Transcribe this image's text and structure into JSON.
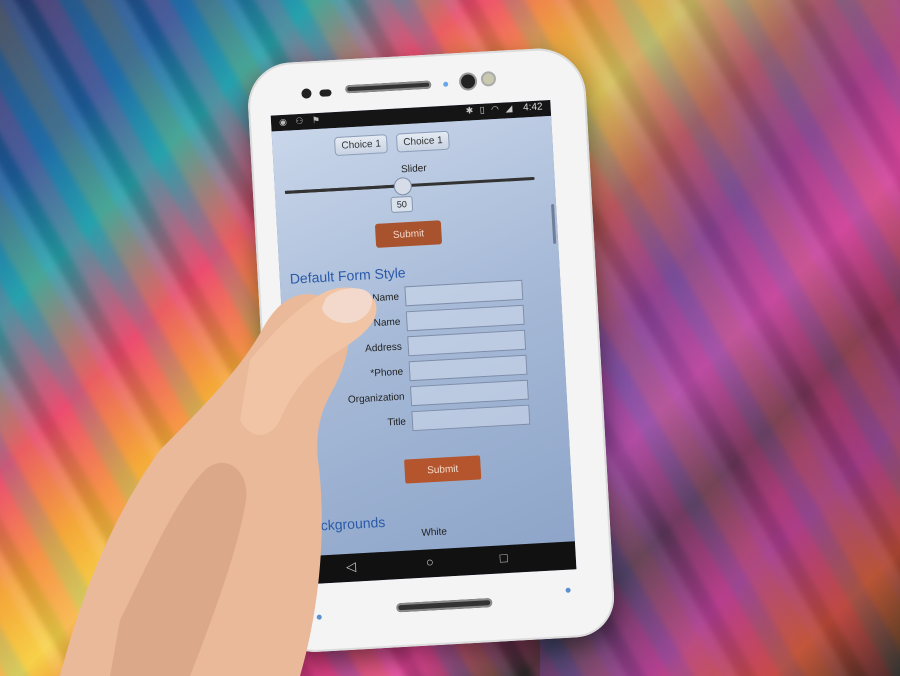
{
  "status_bar": {
    "time": "4:42",
    "left_icons": "notifications-icons",
    "right_icons": "bluetooth-vibrate-wifi-signal-battery"
  },
  "page": {
    "choices": [
      "Choice 1",
      "Choice 1"
    ],
    "slider": {
      "label": "Slider",
      "value": "50",
      "level": 0.5
    },
    "submit_top": "Submit",
    "form_section_title": "Default Form Style",
    "form_fields": [
      {
        "label": "Name"
      },
      {
        "label": "Name"
      },
      {
        "label": "Address"
      },
      {
        "label": "*Phone"
      },
      {
        "label": "Organization"
      },
      {
        "label": "Title"
      }
    ],
    "submit_form": "Submit",
    "backgrounds_title": "Backgrounds",
    "backgrounds_value": "White"
  },
  "nav_bar": {
    "back": "◁",
    "home": "○",
    "recent": "□"
  },
  "colors": {
    "accent_button": "#b4552d",
    "section_title": "#2a5aa8",
    "screen_bg": "#a8bbd8"
  }
}
